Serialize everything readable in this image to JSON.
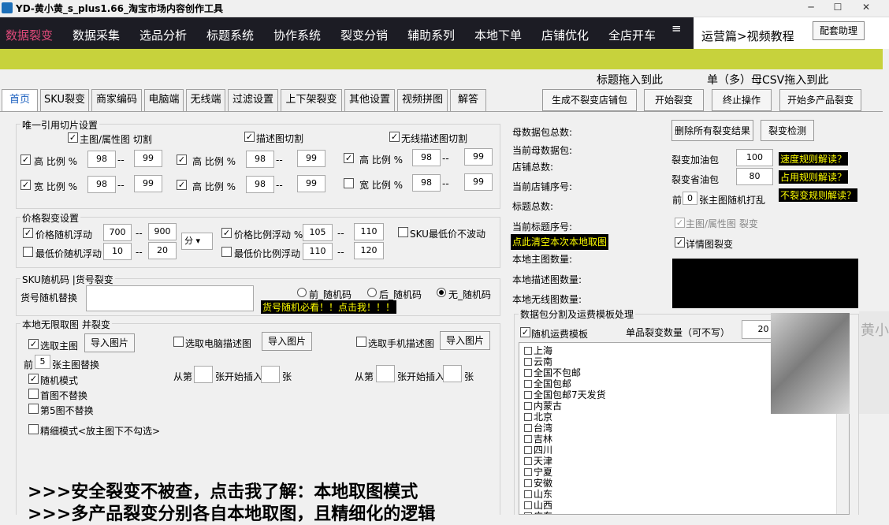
{
  "window": {
    "title": "YD-黄小黄_s_plus1.66_淘宝市场内容创作工具",
    "min": "─",
    "max": "☐",
    "close": "✕"
  },
  "nav": {
    "items": [
      "数据裂变",
      "数据采集",
      "选品分析",
      "标题系统",
      "协作系统",
      "裂变分销",
      "辅助系列",
      "本地下单",
      "店铺优化",
      "全店开车"
    ],
    "menu_icon": "≡",
    "video_tutorial": "运营篇>视频教程",
    "help": "配套助理"
  },
  "drop": {
    "title_label": "标题拖入到此",
    "csv_label": "单（多）母CSV拖入到此"
  },
  "tabs": [
    "首页",
    "SKU裂变",
    "商家编码",
    "电脑端",
    "无线端",
    "过滤设置",
    "上下架裂变",
    "其他设置",
    "视频拼图",
    "解答"
  ],
  "actions": {
    "gen": "生成不裂变店铺包",
    "start": "开始裂变",
    "stop": "终止操作",
    "multi": "开始多产品裂变"
  },
  "slice": {
    "title": "唯一引用切片设置",
    "cb_main": "主图/属性图 切割",
    "cb_desc": "描述图切割",
    "cb_wireless": "无线描述图切割",
    "high": "高 比例 %",
    "wide": "宽 比例 %",
    "dash": "--",
    "v98": "98",
    "v99": "99"
  },
  "price": {
    "title": "价格裂变设置",
    "random": "价格随机浮动",
    "min": "最低价随机浮动",
    "ratio": "价格比例浮动 %",
    "minratio": "最低价比例浮动",
    "sku_min": "SKU最低价不波动",
    "v700": "700",
    "v900": "900",
    "unit": "分",
    "v10": "10",
    "v20": "20",
    "v105": "105",
    "v110a": "110",
    "v110b": "110",
    "v120": "120"
  },
  "sku": {
    "title": "SKU随机码 |货号裂变",
    "replace": "货号随机替换",
    "front": "前_随机码",
    "back": "后_随机码",
    "none": "无_随机码",
    "must": "货号随机必看！！点击我！！！"
  },
  "local": {
    "title": "本地无限取图   并裂变",
    "take_main": "选取主图",
    "import": "导入图片",
    "take_pc": "选取电脑描述图",
    "take_mobile": "选取手机描述图",
    "front": "前",
    "n5": "5",
    "replace": "张主图替换",
    "random": "随机模式",
    "first": "首图不替换",
    "fifth": "第5图不替换",
    "fine": "精细模式<放主图下不勾选>",
    "from": "从第",
    "insert": "张开始插入",
    "zhang": "张"
  },
  "promo": {
    "line1": ">>>安全裂变不被查，点击我了解：本地取图模式",
    "line2": ">>>多产品裂变分别各自本地取图，且精细化的逻辑"
  },
  "stats": {
    "total": "母数据包总数:",
    "cur": "当前母数据包:",
    "shops": "店铺总数:",
    "shop_no": "当前店铺序号:",
    "titles": "标题总数:",
    "title_no": "当前标题序号:",
    "clear": "点此清空本次本地取图",
    "main_cnt": "本地主图数量:",
    "desc_cnt": "本地描述图数量:",
    "wl_cnt": "本地无线图数量:"
  },
  "right": {
    "del_all": "删除所有裂变结果",
    "check": "裂变检测",
    "oil_add": "裂变加油包",
    "oil_save": "裂变省油包",
    "v100": "100",
    "v80": "80",
    "speed": "速度规则解读？",
    "occupy": "占用规则解读？",
    "noflip": "不裂变规则解读？",
    "front": "前",
    "n0": "0",
    "shuffle": "张主图随机打乱",
    "attr": "主图/属性图 裂变",
    "detail": "详情图裂变"
  },
  "split": {
    "title": "数据包分割及运费模板处理",
    "random_tpl": "随机运费模板",
    "single": "单品裂变数量（可不写）",
    "v20": "20",
    "provinces": [
      "上海",
      "云南",
      "全国不包邮",
      "全国包邮",
      "全国包邮7天发货",
      "内蒙古",
      "北京",
      "台湾",
      "吉林",
      "四川",
      "天津",
      "宁夏",
      "安徽",
      "山东",
      "山西",
      "广东"
    ]
  },
  "ghost": {
    "name": "黄小"
  }
}
